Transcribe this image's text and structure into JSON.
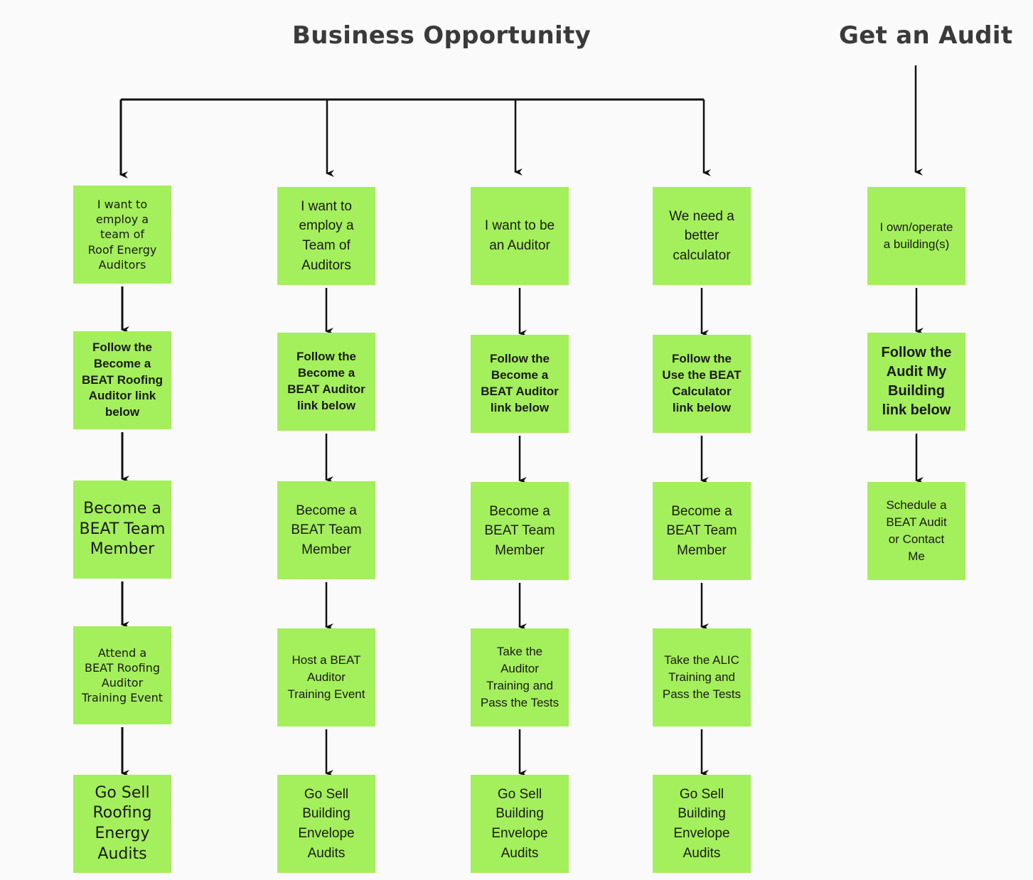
{
  "titles": {
    "business": "Business Opportunity",
    "audit": "Get an Audit"
  },
  "colors": {
    "box_fill": "#a4ef5c",
    "arrow": "#111111",
    "background": "#fafafa"
  },
  "columns": [
    {
      "steps": [
        "I want to employ a team of Roof Energy Auditors",
        "Follow the Become a BEAT Roofing Auditor link below",
        "Become a BEAT Team Member",
        "Attend a BEAT Roofing Auditor Training Event",
        "Go Sell Roofing Energy Audits"
      ]
    },
    {
      "steps": [
        "I want to employ a Team of Auditors",
        "Follow the Become a BEAT Auditor link below",
        "Become a BEAT Team Member",
        "Host a BEAT Auditor Training Event",
        "Go Sell Building Envelope Audits"
      ]
    },
    {
      "steps": [
        "I want to be an Auditor",
        "Follow the Become a BEAT Auditor link below",
        "Become a BEAT Team Member",
        "Take the Auditor Training and Pass the Tests",
        "Go Sell Building Envelope Audits"
      ]
    },
    {
      "steps": [
        "We need a better calculator",
        "Follow the Use the BEAT Calculator link below",
        "Become a BEAT Team Member",
        "Take the ALIC Training and Pass the Tests",
        "Go Sell Building Envelope Audits"
      ]
    },
    {
      "steps": [
        "I own/operate a building(s)",
        "Follow the Audit My Building link below",
        "Schedule a BEAT Audit or Contact Me"
      ]
    }
  ]
}
